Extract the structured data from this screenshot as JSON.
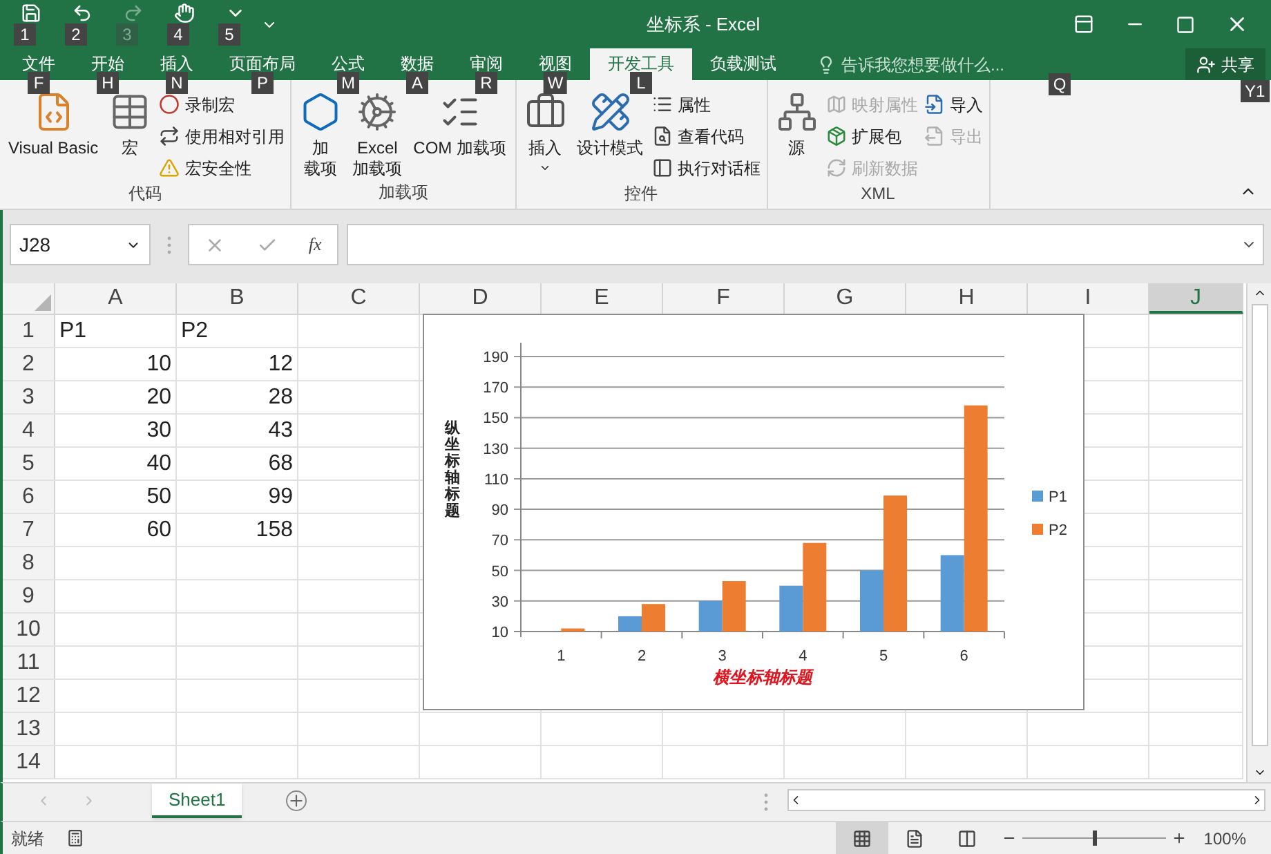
{
  "window": {
    "title": "坐标系 - Excel"
  },
  "quick_access": [
    {
      "key": "1",
      "disabled": false
    },
    {
      "key": "2",
      "disabled": false
    },
    {
      "key": "3",
      "disabled": true
    },
    {
      "key": "4",
      "disabled": false
    },
    {
      "key": "5",
      "disabled": false
    }
  ],
  "tabs": [
    {
      "label": "文件",
      "key": "F",
      "selected": false
    },
    {
      "label": "开始",
      "key": "H",
      "selected": false
    },
    {
      "label": "插入",
      "key": "N",
      "selected": false
    },
    {
      "label": "页面布局",
      "key": "P",
      "selected": false
    },
    {
      "label": "公式",
      "key": "M",
      "selected": false
    },
    {
      "label": "数据",
      "key": "A",
      "selected": false
    },
    {
      "label": "审阅",
      "key": "R",
      "selected": false
    },
    {
      "label": "视图",
      "key": "W",
      "selected": false
    },
    {
      "label": "开发工具",
      "key": "L",
      "selected": true
    },
    {
      "label": "负载测试",
      "selected": false
    }
  ],
  "tell_me": {
    "placeholder": "告诉我您想要做什么...",
    "key": "Q"
  },
  "share": {
    "label": "共享",
    "key": "Y1"
  },
  "ribbon_groups": [
    {
      "label": "代码",
      "items": [
        {
          "kind": "large",
          "lines": [
            "Visual Basic"
          ]
        },
        {
          "kind": "large",
          "lines": [
            "宏"
          ]
        },
        {
          "kind": "stack",
          "items": [
            {
              "label": "录制宏",
              "disabled": false
            },
            {
              "label": "使用相对引用",
              "disabled": false
            },
            {
              "label": "宏安全性",
              "disabled": false
            }
          ]
        }
      ]
    },
    {
      "label": "加载项",
      "items": [
        {
          "kind": "large",
          "lines": [
            "加",
            "载项"
          ]
        },
        {
          "kind": "large",
          "lines": [
            "Excel",
            "加载项"
          ]
        },
        {
          "kind": "large",
          "lines": [
            "COM 加载项"
          ]
        }
      ]
    },
    {
      "label": "控件",
      "items": [
        {
          "kind": "large",
          "lines": [
            "插入"
          ],
          "dropdown": true
        },
        {
          "kind": "large",
          "lines": [
            "设计模式"
          ]
        },
        {
          "kind": "stack",
          "items": [
            {
              "label": "属性",
              "disabled": false
            },
            {
              "label": "查看代码",
              "disabled": false
            },
            {
              "label": "执行对话框",
              "disabled": false
            }
          ]
        }
      ]
    },
    {
      "label": "XML",
      "items": [
        {
          "kind": "large",
          "lines": [
            "源"
          ]
        },
        {
          "kind": "stack",
          "items": [
            {
              "label": "映射属性",
              "disabled": true
            },
            {
              "label": "扩展包",
              "disabled": false
            },
            {
              "label": "刷新数据",
              "disabled": true
            }
          ]
        },
        {
          "kind": "stack",
          "items": [
            {
              "label": "导入",
              "disabled": false
            },
            {
              "label": "导出",
              "disabled": true
            }
          ]
        }
      ]
    }
  ],
  "formula_bar": {
    "name_box": "J28",
    "fx": "fx"
  },
  "columns": [
    {
      "label": "A",
      "selected": false
    },
    {
      "label": "B",
      "selected": false
    },
    {
      "label": "C",
      "selected": false
    },
    {
      "label": "D",
      "selected": false
    },
    {
      "label": "E",
      "selected": false
    },
    {
      "label": "F",
      "selected": false
    },
    {
      "label": "G",
      "selected": false
    },
    {
      "label": "H",
      "selected": false
    },
    {
      "label": "I",
      "selected": false
    },
    {
      "label": "J",
      "selected": true
    }
  ],
  "rows": [
    {
      "number": "1",
      "cells": [
        {
          "text": "P1",
          "kind": "text"
        },
        {
          "text": "P2",
          "kind": "text"
        }
      ]
    },
    {
      "number": "2",
      "cells": [
        {
          "text": "10",
          "kind": "number"
        },
        {
          "text": "12",
          "kind": "number"
        }
      ]
    },
    {
      "number": "3",
      "cells": [
        {
          "text": "20",
          "kind": "number"
        },
        {
          "text": "28",
          "kind": "number"
        }
      ]
    },
    {
      "number": "4",
      "cells": [
        {
          "text": "30",
          "kind": "number"
        },
        {
          "text": "43",
          "kind": "number"
        }
      ]
    },
    {
      "number": "5",
      "cells": [
        {
          "text": "40",
          "kind": "number"
        },
        {
          "text": "68",
          "kind": "number"
        }
      ]
    },
    {
      "number": "6",
      "cells": [
        {
          "text": "50",
          "kind": "number"
        },
        {
          "text": "99",
          "kind": "number"
        }
      ]
    },
    {
      "number": "7",
      "cells": [
        {
          "text": "60",
          "kind": "number"
        },
        {
          "text": "158",
          "kind": "number"
        }
      ]
    },
    {
      "number": "8",
      "cells": []
    },
    {
      "number": "9",
      "cells": []
    },
    {
      "number": "10",
      "cells": []
    },
    {
      "number": "11",
      "cells": []
    },
    {
      "number": "12",
      "cells": []
    },
    {
      "number": "13",
      "cells": []
    },
    {
      "number": "14",
      "cells": []
    }
  ],
  "chart": {
    "chart_data": {
      "type": "bar",
      "xlabel": "横坐标轴标题",
      "ylabel": "纵坐标轴标题",
      "categories": [
        "1",
        "2",
        "3",
        "4",
        "5",
        "6"
      ],
      "series": [
        {
          "name": "P1",
          "color": "#5b9bd5",
          "values": [
            10,
            20,
            30,
            40,
            50,
            60
          ]
        },
        {
          "name": "P2",
          "color": "#ed7d31",
          "values": [
            12,
            28,
            43,
            68,
            99,
            158
          ]
        }
      ],
      "ylim": [
        10,
        190
      ],
      "yticks": [
        10,
        30,
        50,
        70,
        90,
        110,
        130,
        150,
        170,
        190
      ],
      "grid": true,
      "legend": true
    }
  },
  "sheet_tabs": [
    {
      "label": "Sheet1",
      "selected": true
    }
  ],
  "status_bar": {
    "text": "就绪",
    "views": [
      {
        "selected": true
      },
      {
        "selected": false
      },
      {
        "selected": false
      }
    ],
    "zoom": {
      "level": 0.5,
      "reading": "100%"
    }
  }
}
